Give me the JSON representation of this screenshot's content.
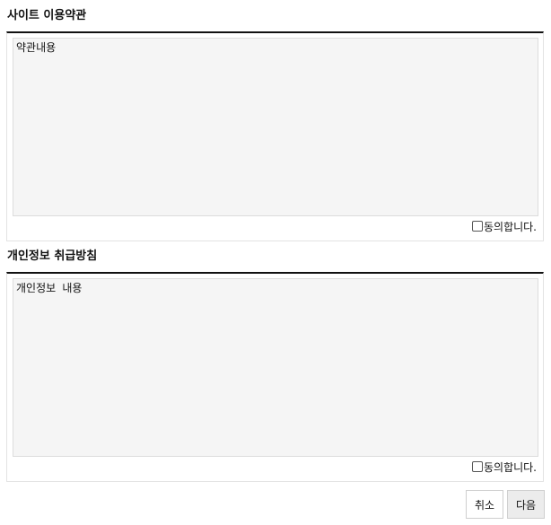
{
  "terms": {
    "title": "사이트 이용약관",
    "content": "약관내용",
    "agree_label": "동의합니다."
  },
  "privacy": {
    "title": "개인정보 취급방침",
    "content": "개인정보 내용",
    "agree_label": "동의합니다."
  },
  "actions": {
    "cancel_label": "취소",
    "next_label": "다음"
  },
  "colors": {
    "title_bar_border": "#111111",
    "textarea_bg": "#f5f5f5",
    "next_button_bg": "#ececec"
  }
}
